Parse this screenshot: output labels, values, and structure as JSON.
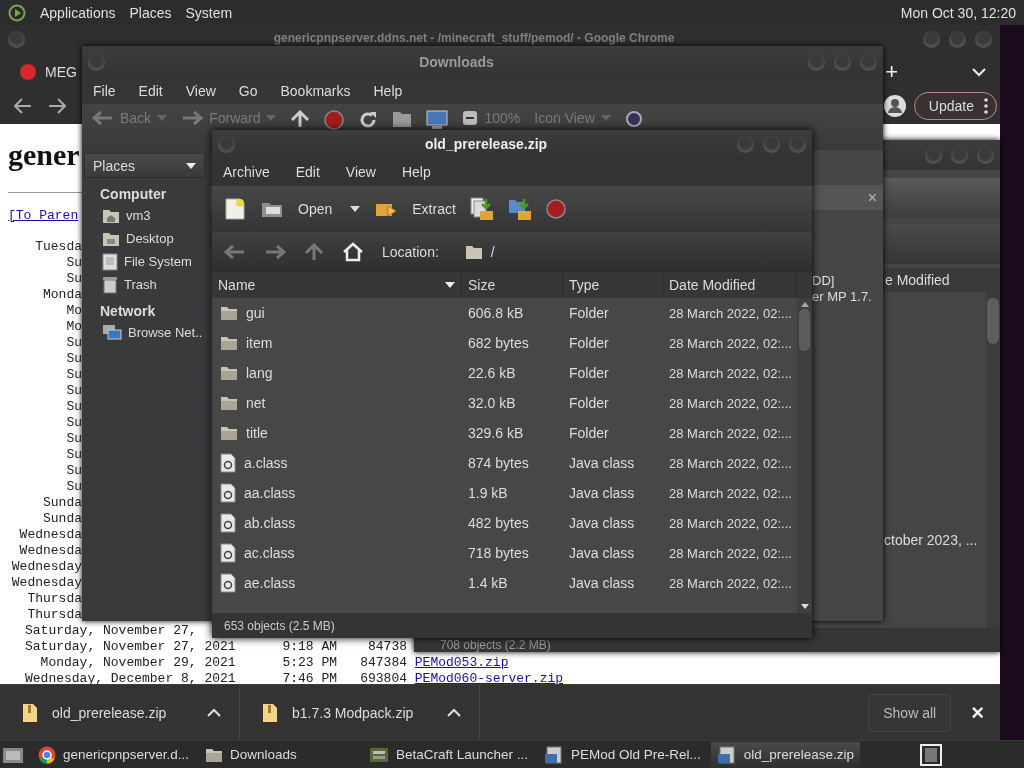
{
  "top_panel": {
    "menus": [
      "Applications",
      "Places",
      "System"
    ],
    "clock": "Mon Oct 30, 12:20"
  },
  "browser": {
    "title": "genericpnpserver.ddns.net - /minecraft_stuff/pemod/ - Google Chrome",
    "tab": "MEG",
    "new_tab": "+",
    "update_button": "Update",
    "page": {
      "heading": "gener",
      "parent_link": "[To Paren",
      "date_fragments": [
        "Tuesda",
        "Su",
        "Su",
        "Monda",
        "Mo",
        "Mo",
        "Su",
        "Su",
        "Su",
        "Su",
        "Su",
        "Su",
        "Su",
        "Su",
        "Su",
        "Su",
        "Sunda",
        "Sunda",
        "Wednesda",
        "Wednesda",
        "Wednesday",
        "Wednesday",
        "Thursda",
        "Thursda"
      ],
      "rows": [
        {
          "date": "Saturday, November 27,"
        },
        {
          "date": "Saturday, November 27, 2021",
          "time": "9:18 AM",
          "size": "84738"
        },
        {
          "date": "Monday, November 29, 2021",
          "time": "5:23 PM",
          "size": "847384",
          "file": "PEMod053.zip"
        },
        {
          "date": "Wednesday, December 8, 2021",
          "time": "7:46 PM",
          "size": "693804",
          "file": "PEMod060-server.zip"
        }
      ]
    },
    "downloads_bar": {
      "items": [
        {
          "name": "old_prerelease.zip"
        },
        {
          "name": "b1.7.3 Modpack.zip"
        }
      ],
      "show_all": "Show all",
      "close": "×"
    }
  },
  "file_manager": {
    "title": "Downloads",
    "menus": [
      "File",
      "Edit",
      "View",
      "Go",
      "Bookmarks",
      "Help"
    ],
    "toolbar": [
      {
        "kind": "back",
        "label": "Back"
      },
      {
        "kind": "forward",
        "label": "Forward"
      },
      {
        "kind": "up"
      },
      {
        "kind": "stop"
      },
      {
        "kind": "reload"
      },
      {
        "kind": "folder"
      },
      {
        "kind": "computer"
      },
      {
        "kind": "zoom",
        "label": "100%"
      },
      {
        "kind": "view",
        "label": "Icon View"
      },
      {
        "kind": "search"
      }
    ],
    "places_selector": "Places",
    "sidebar": [
      {
        "heading": "Computer",
        "items": [
          {
            "label": "vm3",
            "kind": "home"
          },
          {
            "label": "Desktop",
            "kind": "desktop"
          },
          {
            "label": "File System",
            "kind": "drive"
          },
          {
            "label": "Trash",
            "kind": "trash"
          }
        ]
      },
      {
        "heading": "Network",
        "items": [
          {
            "label": "Browse Net..",
            "kind": "network"
          }
        ]
      }
    ],
    "info_bar_close": "×",
    "file_labels": [
      "DD]",
      "er MP 1.7."
    ]
  },
  "back_archive": {
    "column_header": "e Modified",
    "cell": "ctober 2023, ...",
    "status": "708 objects (2.2 MB)"
  },
  "archive": {
    "title": "old_prerelease.zip",
    "menus": [
      "Archive",
      "Edit",
      "View",
      "Help"
    ],
    "toolbar": [
      {
        "kind": "new"
      },
      {
        "kind": "open",
        "label": "Open"
      },
      {
        "kind": "extract",
        "label": "Extract"
      },
      {
        "kind": "add_files"
      },
      {
        "kind": "add_folder"
      },
      {
        "kind": "stop"
      }
    ],
    "location": {
      "label": "Location:",
      "path": "/"
    },
    "columns": [
      "Name",
      "Size",
      "Type",
      "Date Modified"
    ],
    "rows": [
      {
        "kind": "folder",
        "name": "gui",
        "size": "606.8 kB",
        "type": "Folder",
        "date": "28 March 2022, 02:..."
      },
      {
        "kind": "folder",
        "name": "item",
        "size": "682 bytes",
        "type": "Folder",
        "date": "28 March 2022, 02:..."
      },
      {
        "kind": "folder",
        "name": "lang",
        "size": "22.6 kB",
        "type": "Folder",
        "date": "28 March 2022, 02:..."
      },
      {
        "kind": "folder",
        "name": "net",
        "size": "32.0 kB",
        "type": "Folder",
        "date": "28 March 2022, 02:..."
      },
      {
        "kind": "folder",
        "name": "title",
        "size": "329.6 kB",
        "type": "Folder",
        "date": "28 March 2022, 02:..."
      },
      {
        "kind": "class",
        "name": "a.class",
        "size": "874 bytes",
        "type": "Java class",
        "date": "28 March 2022, 02:..."
      },
      {
        "kind": "class",
        "name": "aa.class",
        "size": "1.9 kB",
        "type": "Java class",
        "date": "28 March 2022, 02:..."
      },
      {
        "kind": "class",
        "name": "ab.class",
        "size": "482 bytes",
        "type": "Java class",
        "date": "28 March 2022, 02:..."
      },
      {
        "kind": "class",
        "name": "ac.class",
        "size": "718 bytes",
        "type": "Java class",
        "date": "28 March 2022, 02:..."
      },
      {
        "kind": "class",
        "name": "ae.class",
        "size": "1.4 kB",
        "type": "Java class",
        "date": "28 March 2022, 02:..."
      }
    ],
    "status": "653 objects (2.5 MB)"
  },
  "taskbar": {
    "items": [
      {
        "kind": "browser",
        "label": "genericpnpserver.d...",
        "selected": false
      },
      {
        "kind": "folder",
        "label": "Downloads",
        "selected": false
      },
      {
        "kind": "app",
        "label": "BetaCraft Launcher ...",
        "selected": false
      },
      {
        "kind": "archive",
        "label": "PEMod Old Pre-Rel...",
        "selected": false
      },
      {
        "kind": "archive",
        "label": "old_prerelease.zip",
        "selected": true
      }
    ]
  }
}
